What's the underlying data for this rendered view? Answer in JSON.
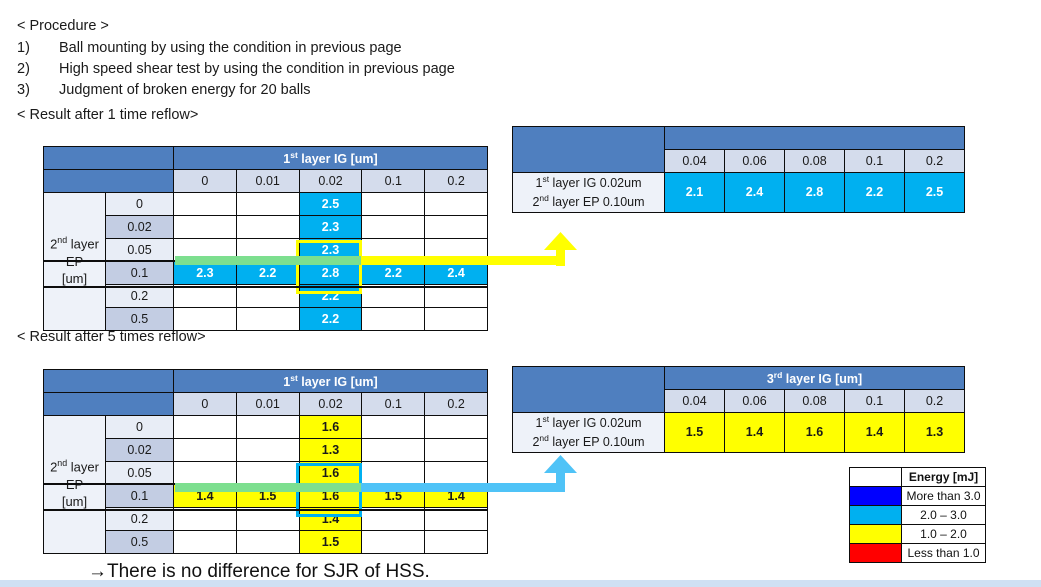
{
  "procedure": {
    "heading": "< Procedure >",
    "steps": [
      {
        "num": "1)",
        "text": "Ball mounting by using the condition in previous page"
      },
      {
        "num": "2)",
        "text": "High speed shear test by using the condition in previous page"
      },
      {
        "num": "3)",
        "text": "Judgment of broken energy for 20 balls"
      }
    ]
  },
  "sections": {
    "reflow1_heading": "< Result  after 1 time reflow>",
    "reflow5_heading": "< Result  after 5 times reflow>"
  },
  "conclusion": "→There is no difference for SJR of HSS.",
  "matrix": {
    "col_group_label_html": "1<sup>st</sup> layer IG [um]",
    "col_headers": [
      "0",
      "0.01",
      "0.02",
      "0.1",
      "0.2"
    ],
    "row_axis_label_html": "2<sup>nd</sup> layer<br>EP<br>[um]",
    "row_headers": [
      "0",
      "0.02",
      "0.05",
      "0.1",
      "0.2",
      "0.5"
    ],
    "reflow1": {
      "highlight_column_index": 2,
      "highlight_row_index": 3,
      "cells": [
        [
          "",
          "",
          "2.5",
          "",
          ""
        ],
        [
          "",
          "",
          "2.3",
          "",
          ""
        ],
        [
          "",
          "",
          "2.3",
          "",
          ""
        ],
        [
          "2.3",
          "2.2",
          "2.8",
          "2.2",
          "2.4"
        ],
        [
          "",
          "",
          "2.2",
          "",
          ""
        ],
        [
          "",
          "",
          "2.2",
          "",
          ""
        ]
      ]
    },
    "reflow5": {
      "highlight_column_index": 2,
      "highlight_row_index": 3,
      "cells": [
        [
          "",
          "",
          "1.6",
          "",
          ""
        ],
        [
          "",
          "",
          "1.3",
          "",
          ""
        ],
        [
          "",
          "",
          "1.6",
          "",
          ""
        ],
        [
          "1.4",
          "1.5",
          "1.6",
          "1.5",
          "1.4"
        ],
        [
          "",
          "",
          "1.4",
          "",
          ""
        ],
        [
          "",
          "",
          "1.5",
          "",
          ""
        ]
      ]
    }
  },
  "summary": {
    "row_label_line1_html": "1<sup>st</sup> layer IG 0.02um",
    "row_label_line2_html": "2<sup>nd</sup> layer EP 0.10um",
    "col_headers": [
      "0.04",
      "0.06",
      "0.08",
      "0.1",
      "0.2"
    ],
    "reflow1": {
      "group_label_html": "",
      "values": [
        "2.1",
        "2.4",
        "2.8",
        "2.2",
        "2.5"
      ]
    },
    "reflow5": {
      "group_label_html": "3<sup>rd</sup> layer IG [um]",
      "values": [
        "1.5",
        "1.4",
        "1.6",
        "1.4",
        "1.3"
      ]
    }
  },
  "legend": {
    "title": "Energy [mJ]",
    "entries": [
      {
        "color": "#0000ff",
        "label": "More than 3.0"
      },
      {
        "color": "#00b0f0",
        "label": "2.0 – 3.0"
      },
      {
        "color": "#ffff00",
        "label": "1.0 – 2.0"
      },
      {
        "color": "#ff0000",
        "label": "Less than 1.0"
      }
    ]
  },
  "connectors": {
    "reflow1_color": "#ffff00",
    "reflow5_color": "#4fc3f7",
    "overlay_highlight_color": "#7ddf8f"
  }
}
